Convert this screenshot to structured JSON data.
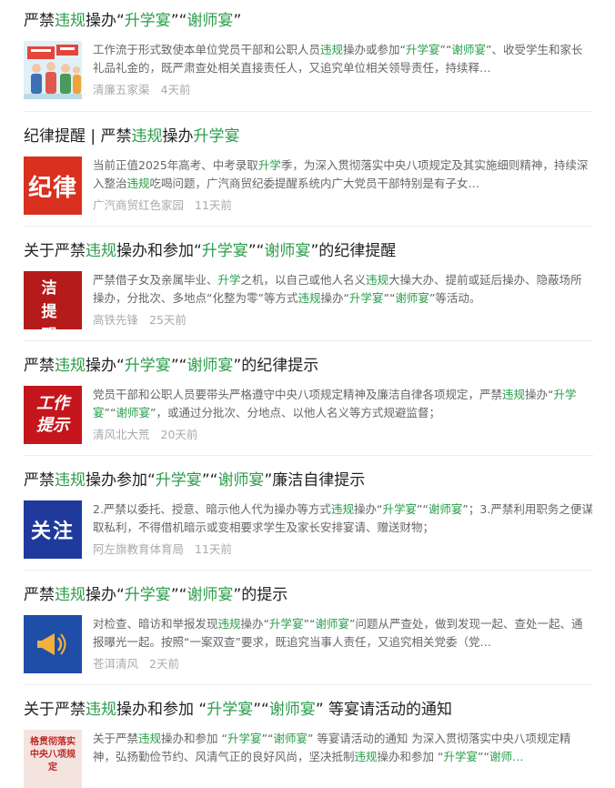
{
  "items": [
    {
      "title": [
        "严禁",
        {
          "hl": "违规"
        },
        "操办“",
        {
          "hl": "升学宴"
        },
        "”“",
        {
          "hl": "谢师宴"
        },
        "”"
      ],
      "snippet": [
        "工作流于形式致使本单位党员干部和公职人员",
        {
          "hl": "违规"
        },
        "操办或参加“",
        {
          "hl": "升学宴"
        },
        "”“",
        {
          "hl": "谢师宴"
        },
        "”、收受学生和家长礼品礼金的，既严肃查处相关直接责任人，又追究单位相关领导责任，持续释…"
      ],
      "source": "清廉五家渠",
      "time": "4天前",
      "thumb": {
        "kind": "illustration",
        "icon": "campaign-illustration-icon",
        "text": ""
      }
    },
    {
      "title": [
        "纪律提醒 | 严禁",
        {
          "hl": "违规"
        },
        "操办",
        {
          "hl": "升学宴"
        }
      ],
      "snippet": [
        "当前正值2025年高考、中考录取",
        {
          "hl": "升学"
        },
        "季，为深入贯彻落实中央八项规定及其实施细则精神，持续深入整治",
        {
          "hl": "违规"
        },
        "吃喝问题，广汽商贸纪委提醒系统内广大党员干部特别是有子女…"
      ],
      "source": "广汽商贸红色家园",
      "time": "11天前",
      "thumb": {
        "kind": "text",
        "icon": "",
        "text": "纪律",
        "bg": "#d9301f"
      }
    },
    {
      "title": [
        "关于严禁",
        {
          "hl": "违规"
        },
        "操办和参加“",
        {
          "hl": "升学宴"
        },
        "”“",
        {
          "hl": "谢师宴"
        },
        "”的纪律提醒"
      ],
      "snippet": [
        "严禁借子女及亲属毕业、",
        {
          "hl": "升学"
        },
        "之机，以自己或他人名义",
        {
          "hl": "违规"
        },
        "大操大办、提前或延后操办、隐蔽场所操办，分批次、多地点“化整为零”等方式",
        {
          "hl": "违规"
        },
        "操办“",
        {
          "hl": "升学宴"
        },
        "”“",
        {
          "hl": "谢师宴"
        },
        "”等活动。"
      ],
      "source": "高铁先锋",
      "time": "25天前",
      "thumb": {
        "kind": "grid",
        "icon": "",
        "text": "廉洁提醒",
        "bg": "#b51b1b"
      }
    },
    {
      "title": [
        "严禁",
        {
          "hl": "违规"
        },
        "操办“",
        {
          "hl": "升学宴"
        },
        "”“",
        {
          "hl": "谢师宴"
        },
        "”的纪律提示"
      ],
      "snippet": [
        "党员干部和公职人员要带头严格遵守中央八项规定精神及廉洁自律各项规定，严禁",
        {
          "hl": "违规"
        },
        "操办“",
        {
          "hl": "升学宴"
        },
        "”“",
        {
          "hl": "谢师宴"
        },
        "”，或通过分批次、分地点、以他人名义等方式规避监督；"
      ],
      "source": "清风北大荒",
      "time": "20天前",
      "thumb": {
        "kind": "text2",
        "icon": "",
        "text": "工作提示",
        "bg": "#c4161c"
      }
    },
    {
      "title": [
        "严禁",
        {
          "hl": "违规"
        },
        "操办参加“",
        {
          "hl": "升学宴"
        },
        "”“",
        {
          "hl": "谢师宴"
        },
        "”廉洁自律提示"
      ],
      "snippet": [
        "2.严禁以委托、授意、暗示他人代为操办等方式",
        {
          "hl": "违规"
        },
        "操办“",
        {
          "hl": "升学宴"
        },
        "”“",
        {
          "hl": "谢师宴"
        },
        "”；3.严禁利用职务之便谋取私利，不得借机暗示或变相要求学生及家长安排宴请、赠送财物；"
      ],
      "source": "阿左旗教育体育局",
      "time": "11天前",
      "thumb": {
        "kind": "text",
        "icon": "",
        "text": "关注",
        "bg": "#1f3a9c"
      }
    },
    {
      "title": [
        "严禁",
        {
          "hl": "违规"
        },
        "操办“",
        {
          "hl": "升学宴"
        },
        "”“",
        {
          "hl": "谢师宴"
        },
        "”的提示"
      ],
      "snippet": [
        "对检查、暗访和举报发现",
        {
          "hl": "违规"
        },
        "操办“",
        {
          "hl": "升学宴"
        },
        "”“",
        {
          "hl": "谢师宴"
        },
        "”问题从严查处，做到发现一起、查处一起、通报曝光一起。按照“一案双查”要求，既追究当事人责任，又追究相关党委（党…"
      ],
      "source": "苍洱清风",
      "time": "2天前",
      "thumb": {
        "kind": "icon",
        "icon": "megaphone-icon",
        "text": "",
        "bg": "#1f4ea8"
      }
    },
    {
      "title": [
        "关于严禁",
        {
          "hl": "违规"
        },
        "操办和参加 “",
        {
          "hl": "升学宴"
        },
        "”“",
        {
          "hl": "谢师宴"
        },
        "” 等宴请活动的通知"
      ],
      "snippet": [
        "关于严禁",
        {
          "hl": "违规"
        },
        "操办和参加 “",
        {
          "hl": "升学宴"
        },
        "”“",
        {
          "hl": "谢师宴"
        },
        "” 等宴请活动的通知 为深入贯彻落实中央八项规定精神，弘扬勤俭节约、风清气正的良好风尚，坚决抵制",
        {
          "hl": "违规"
        },
        "操办和参加 “",
        {
          "hl": "升学宴"
        },
        "”“",
        {
          "hl": "谢师…"
        }
      ],
      "source": "",
      "time": "",
      "thumb": {
        "kind": "banner",
        "icon": "",
        "text": "格贯彻落实中央八项规定",
        "bg": "#f3e4df"
      }
    }
  ]
}
